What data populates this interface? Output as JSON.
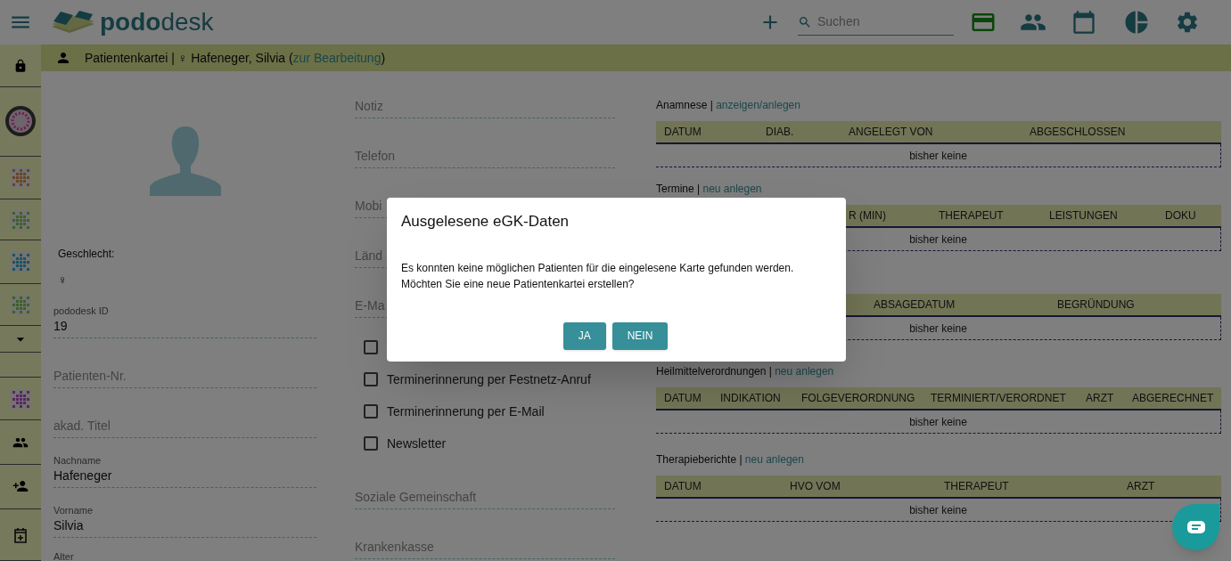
{
  "topbar": {
    "logo": "**podo**desk",
    "search": {
      "placeholder": "Suchen"
    }
  },
  "sidebar": {
    "items": [
      {
        "kind": "lock"
      },
      {
        "kind": "avatar"
      },
      {
        "kind": "flower"
      },
      {
        "kind": "grid"
      },
      {
        "kind": "dots"
      },
      {
        "kind": "grid"
      },
      {
        "kind": "caret"
      },
      {
        "kind": "blank"
      },
      {
        "kind": "wreath"
      },
      {
        "kind": "people"
      },
      {
        "kind": "person-add"
      },
      {
        "kind": "calendar-add"
      }
    ]
  },
  "header": {
    "title": "Patientenkartei | ♀ Hafeneger, Silvia (",
    "link": "zur Bearbeitung",
    "suffix": ")"
  },
  "gender": {
    "label": "Geschlecht:",
    "value": "♀"
  },
  "left_fields": [
    {
      "label": "pododesk ID",
      "value": "19"
    },
    {
      "placeholder": "Patienten-Nr."
    },
    {
      "placeholder": "akad. Titel"
    },
    {
      "label": "Nachname",
      "value": "Hafeneger"
    },
    {
      "label": "Vorname",
      "value": "Silvia"
    },
    {
      "label": "Alter"
    }
  ],
  "middle_fields": [
    {
      "placeholder": "Notiz"
    },
    {
      "placeholder": "Telefon"
    },
    {
      "placeholder": "Mobi"
    },
    {
      "placeholder": "Länd"
    },
    {
      "placeholder": "E-Ma"
    }
  ],
  "checkboxes": [
    {
      "checked": false
    },
    {
      "label": "Terminerinnerung per Festnetz-Anruf",
      "checked": false
    },
    {
      "label": "Terminerinnerung per E-Mail",
      "checked": false
    },
    {
      "label": "Newsletter",
      "checked": false
    }
  ],
  "middle_fields_2": [
    {
      "placeholder": "Soziale Gemeinschaft"
    },
    {
      "placeholder": "Krankenkasse"
    }
  ],
  "tables": [
    {
      "title": "Anamnese | ",
      "link": "anzeigen/anlegen",
      "columns": [
        "DATUM",
        "DIAB.",
        "ANGELEGT VON",
        "ABGESCHLOSSEN"
      ],
      "empty": "bisher keine"
    },
    {
      "title": "Termine | ",
      "link": "neu anlegen",
      "columns": [
        "",
        "R (MIN)",
        "THERAPEUT",
        "LEISTUNGEN",
        "DOKU"
      ],
      "empty": "bisher keine"
    },
    {
      "columns": [
        "",
        "ABSAGEDATUM",
        "BEGRÜNDUNG"
      ],
      "empty": "bisher keine"
    },
    {
      "title": "Heilmittelverordnungen | ",
      "link": "neu anlegen",
      "columns": [
        "DATUM",
        "INDIKATION",
        "FOLGEVERORDNUNG",
        "TERMINIERT/VERORDNET",
        "ARZT",
        "ABGERECHNET"
      ],
      "empty": "bisher keine"
    },
    {
      "title": "Therapieberichte | ",
      "link": "neu anlegen",
      "columns": [
        "DATUM",
        "HVO VOM",
        "THERAPEUT",
        "ARZT"
      ],
      "empty": "bisher keine"
    }
  ],
  "dialog": {
    "title": "Ausgelesene eGK-Daten",
    "message": [
      "Es konnten keine möglichen Patienten für die eingelesene Karte gefunden werden.",
      "Möchten Sie eine neue Patientenkartei erstellen?"
    ],
    "buttons": [
      "JA",
      "NEIN"
    ]
  }
}
